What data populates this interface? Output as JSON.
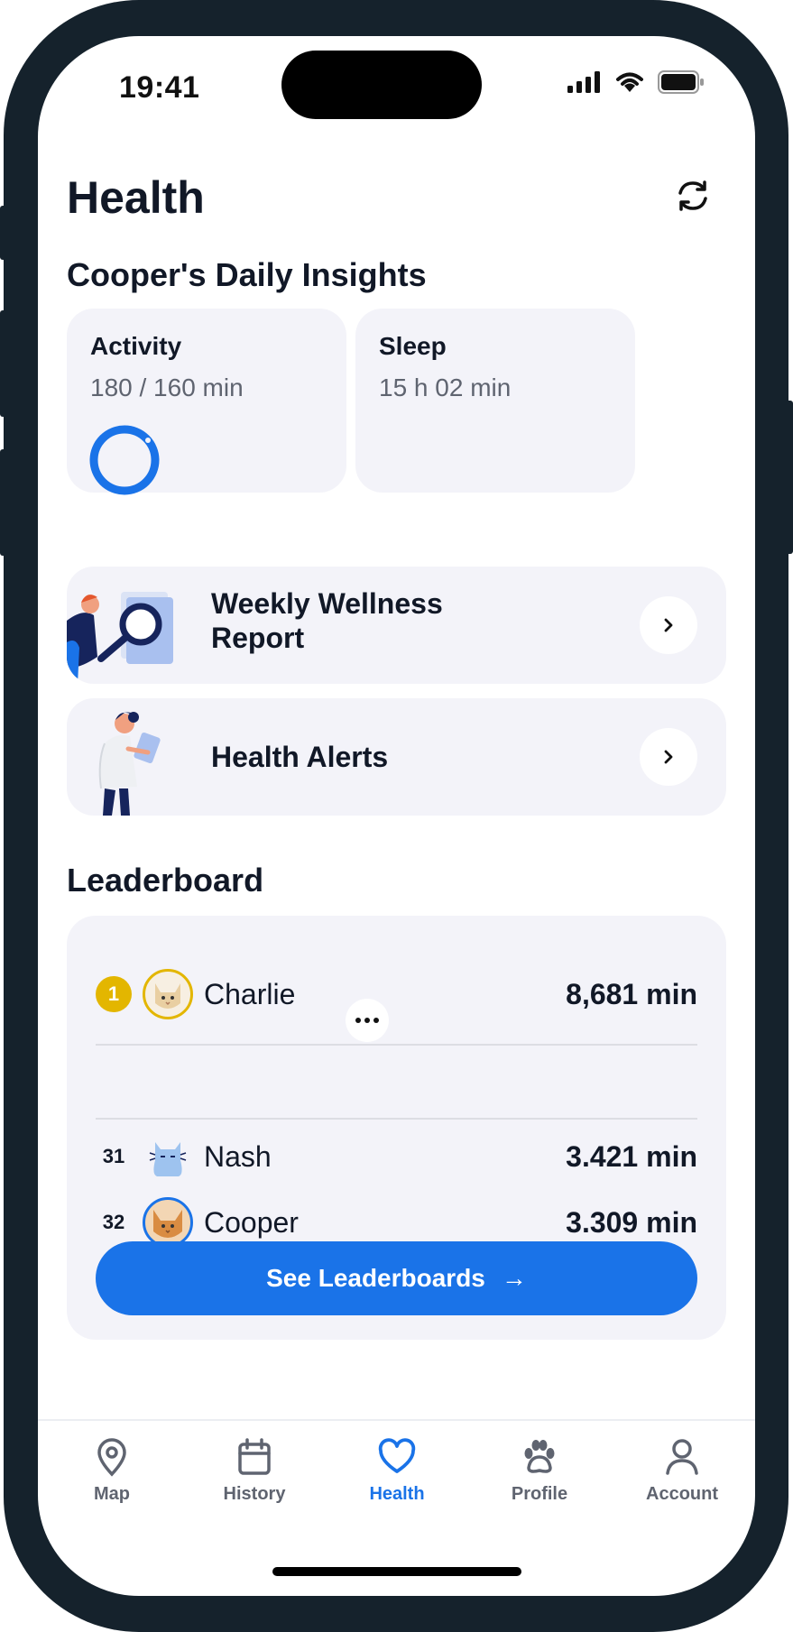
{
  "status_bar": {
    "time": "19:41"
  },
  "header": {
    "title": "Health",
    "refresh_icon": "refresh-icon"
  },
  "insights": {
    "heading": "Cooper's Daily Insights",
    "activity": {
      "label": "Activity",
      "value": "180 / 160 min",
      "progress": 1.0
    },
    "sleep": {
      "label": "Sleep",
      "value": "15 h 02 min"
    }
  },
  "links": [
    {
      "label_line1": "Weekly Wellness",
      "label_line2": "Report",
      "icon": "chevron-right-icon"
    },
    {
      "label": "Health Alerts",
      "icon": "chevron-right-icon"
    }
  ],
  "leaderboard": {
    "heading": "Leaderboard",
    "rows": [
      {
        "rank": "1",
        "name": "Charlie",
        "score": "8,681 min"
      },
      {
        "rank": "31",
        "name": "Nash",
        "score": "3.421 min"
      },
      {
        "rank": "32",
        "name": "Cooper",
        "score": "3.309 min"
      }
    ],
    "cta": "See Leaderboards",
    "cta_arrow": "→"
  },
  "tabs": [
    {
      "label": "Map",
      "icon": "map-pin-icon"
    },
    {
      "label": "History",
      "icon": "calendar-icon"
    },
    {
      "label": "Health",
      "icon": "heart-icon",
      "active": true
    },
    {
      "label": "Profile",
      "icon": "paw-icon"
    },
    {
      "label": "Account",
      "icon": "user-icon"
    }
  ],
  "colors": {
    "accent": "#1a73e8",
    "gold": "#e3b600",
    "card_bg": "#f3f3f9",
    "frame": "#15222c"
  }
}
